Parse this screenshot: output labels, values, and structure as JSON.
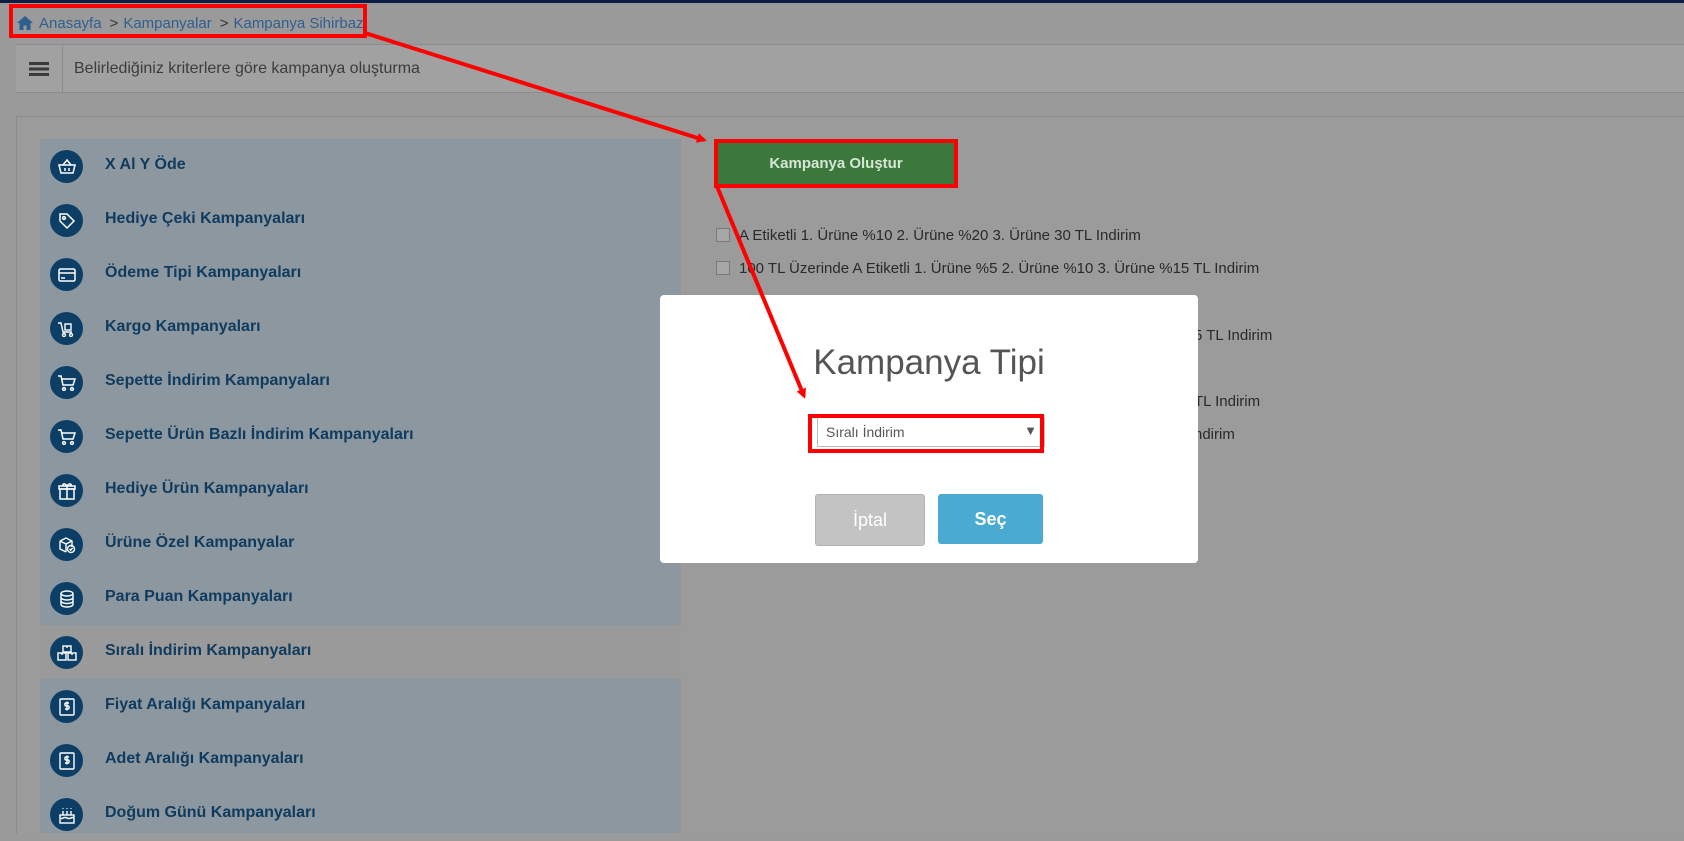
{
  "breadcrumb": {
    "home": "Anasayfa",
    "separator": ">",
    "items": [
      "Kampanyalar",
      "Kampanya Sihirbazı"
    ]
  },
  "header": {
    "title": "Belirlediğiniz kriterlere göre kampanya oluşturma"
  },
  "categories": [
    {
      "label": "X Al Y Öde",
      "icon": "basket-icon"
    },
    {
      "label": "Hediye Çeki Kampanyaları",
      "icon": "tag-icon"
    },
    {
      "label": "Ödeme Tipi Kampanyaları",
      "icon": "credit-card-icon"
    },
    {
      "label": "Kargo Kampanyaları",
      "icon": "cargo-icon"
    },
    {
      "label": "Sepette İndirim Kampanyaları",
      "icon": "cart-icon"
    },
    {
      "label": "Sepette Ürün Bazlı İndirim Kampanyaları",
      "icon": "cart-icon"
    },
    {
      "label": "Hediye Ürün Kampanyaları",
      "icon": "gift-icon"
    },
    {
      "label": "Ürüne Özel Kampanyalar",
      "icon": "box-check-icon"
    },
    {
      "label": "Para Puan Kampanyaları",
      "icon": "coins-icon"
    },
    {
      "label": "Sıralı İndirim Kampanyaları",
      "icon": "boxes-icon",
      "active": true
    },
    {
      "label": "Fiyat Aralığı Kampanyaları",
      "icon": "price-doc-icon"
    },
    {
      "label": "Adet Aralığı Kampanyaları",
      "icon": "price-doc-icon"
    },
    {
      "label": "Doğum Günü Kampanyaları",
      "icon": "cake-icon"
    }
  ],
  "actions": {
    "create_label": "Kampanya Oluştur"
  },
  "campaign_options": [
    "A Etiketli 1. Ürüne %10 2. Ürüne %20 3. Ürüne 30 TL Indirim",
    "100 TL Üzerinde A Etiketli 1. Ürüne %5 2. Ürüne %10 3. Ürüne %15 TL Indirim"
  ],
  "campaign_partial_suffixes": [
    "5 TL Indirim",
    "TL Indirim",
    "ndirim"
  ],
  "modal": {
    "title": "Kampanya Tipi",
    "select_value": "Sıralı İndirim",
    "select_arrow": "▼",
    "cancel_label": "İptal",
    "select_label": "Seç"
  },
  "colors": {
    "annotation": "#ff0000",
    "create_button": "#3c773c",
    "primary_button": "#4aaad1",
    "category_icon_bg": "#0d3f66"
  }
}
